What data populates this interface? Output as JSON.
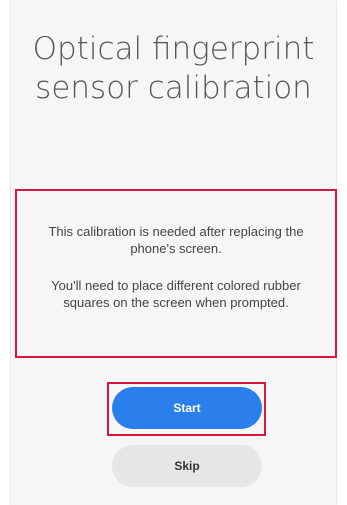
{
  "title": "Optical fingerprint sensor calibration",
  "description": {
    "line1": "This calibration is needed after replacing the phone's screen.",
    "line2": "You'll need to place different colored rubber squares on the screen when prompted."
  },
  "buttons": {
    "start_label": "Start",
    "skip_label": "Skip"
  },
  "colors": {
    "primary": "#2b7fec",
    "secondary": "#e6e6e6",
    "highlight": "#d6183c"
  }
}
